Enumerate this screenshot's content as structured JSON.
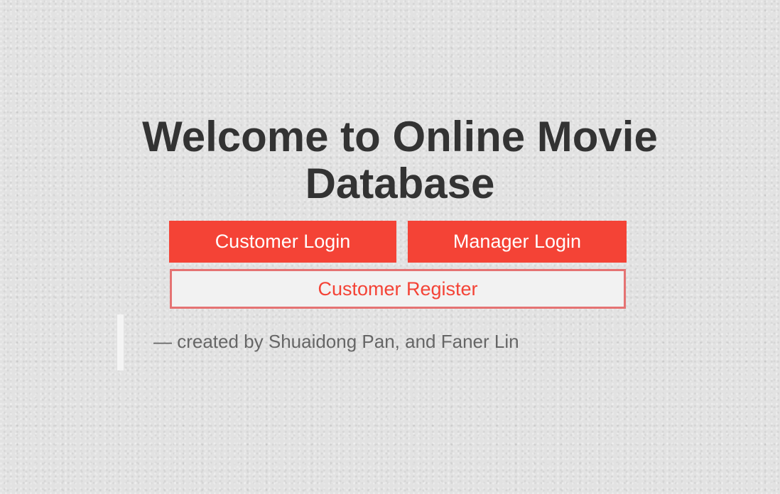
{
  "page": {
    "title": "Welcome to Online Movie Database"
  },
  "actions": {
    "customer_login_label": "Customer Login",
    "manager_login_label": "Manager Login",
    "customer_register_label": "Customer Register"
  },
  "footer": {
    "credit": "— created by Shuaidong Pan, and Faner Lin"
  },
  "colors": {
    "accent": "#f44336",
    "title_text": "#333333",
    "credit_text": "#666666"
  }
}
